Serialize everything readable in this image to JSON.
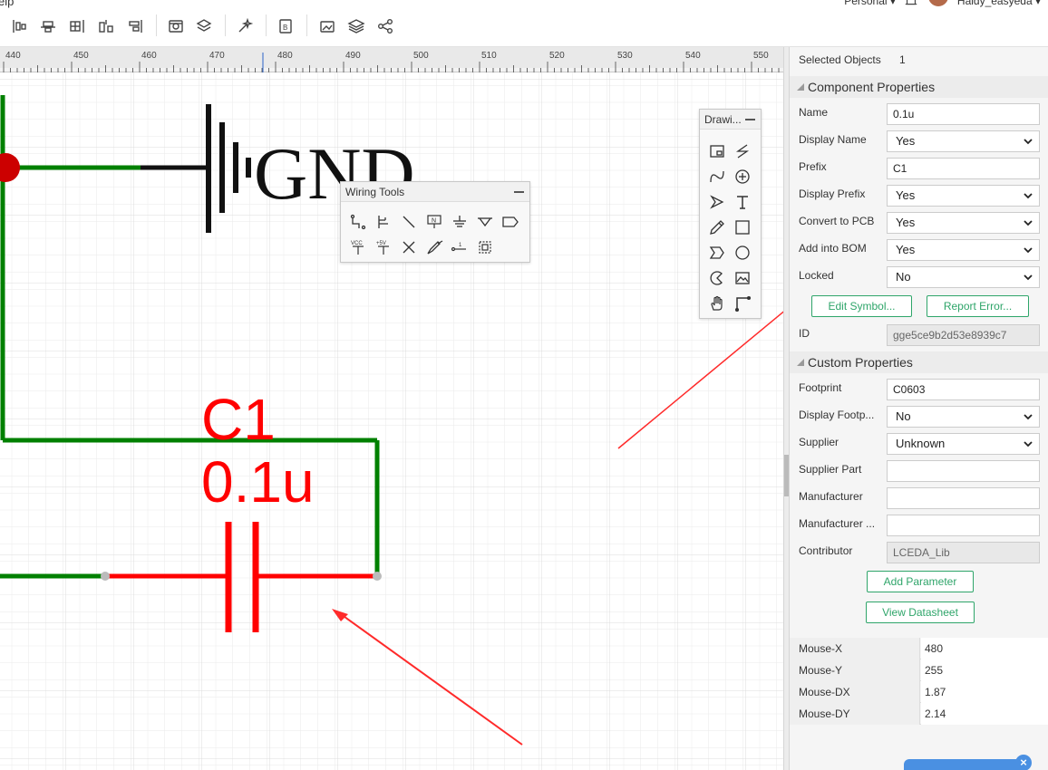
{
  "menu": {
    "help": "elp"
  },
  "user": {
    "workspace": "Personal ▾",
    "username": "Haidy_easyeda ▾"
  },
  "toolbar": {
    "icons": [
      "align-left-icon",
      "align-center-icon",
      "distribute-icon",
      "align-bottom-icon",
      "align-right-icon",
      "image-icon",
      "layers-up-icon",
      "magic-wand-icon",
      "bom-icon",
      "image-export-icon",
      "layers-icon",
      "share-icon"
    ]
  },
  "ruler": {
    "labels": [
      "440",
      "450",
      "460",
      "470",
      "480",
      "490",
      "500",
      "510",
      "520",
      "530",
      "540",
      "550"
    ]
  },
  "schematic": {
    "gnd_label": "GND",
    "ref": "C1",
    "value": "0.1u",
    "wire_color": "#008000",
    "part_color": "#ff0000",
    "junction_color": "#cc0000"
  },
  "wiring_tools": {
    "title": "Wiring Tools",
    "tools": [
      "wire-icon",
      "bus-icon",
      "bus-entry-icon",
      "net-label-icon",
      "ground-icon",
      "net-port-icon",
      "net-flag-icon",
      "vcc-icon",
      "plus5v-icon",
      "no-connect-icon",
      "voltage-probe-icon",
      "pin-icon",
      "group-icon"
    ]
  },
  "drawing_tools": {
    "title": "Drawi...",
    "tools": [
      "rect-image-icon",
      "line-icon",
      "curve-icon",
      "add-circle-icon",
      "arrow-icon",
      "text-icon",
      "pencil-icon",
      "square-icon",
      "chevron-icon",
      "circle-icon",
      "pie-icon",
      "image-icon",
      "hand-icon",
      "corner-icon"
    ]
  },
  "panel": {
    "selected_objects_label": "Selected Objects",
    "selected_objects_value": "1",
    "component_header": "Component Properties",
    "name_label": "Name",
    "name_value": "0.1u",
    "display_name_label": "Display Name",
    "display_name_value": "Yes",
    "prefix_label": "Prefix",
    "prefix_value": "C1",
    "display_prefix_label": "Display Prefix",
    "display_prefix_value": "Yes",
    "convert_pcb_label": "Convert to PCB",
    "convert_pcb_value": "Yes",
    "add_bom_label": "Add into BOM",
    "add_bom_value": "Yes",
    "locked_label": "Locked",
    "locked_value": "No",
    "edit_symbol": "Edit Symbol...",
    "report_error": "Report Error...",
    "id_label": "ID",
    "id_value": "gge5ce9b2d53e8939c7",
    "custom_header": "Custom Properties",
    "footprint_label": "Footprint",
    "footprint_value": "C0603",
    "display_footprint_label": "Display Footp...",
    "display_footprint_value": "No",
    "supplier_label": "Supplier",
    "supplier_value": "Unknown",
    "supplier_part_label": "Supplier Part",
    "supplier_part_value": "",
    "manufacturer_label": "Manufacturer",
    "manufacturer_value": "",
    "manufacturer_part_label": "Manufacturer ...",
    "manufacturer_part_value": "",
    "contributor_label": "Contributor",
    "contributor_value": "LCEDA_Lib",
    "add_parameter": "Add Parameter",
    "view_datasheet": "View Datasheet"
  },
  "mouse": {
    "rows": [
      {
        "key": "Mouse-X",
        "value": "480"
      },
      {
        "key": "Mouse-Y",
        "value": "255"
      },
      {
        "key": "Mouse-DX",
        "value": "1.87"
      },
      {
        "key": "Mouse-DY",
        "value": "2.14"
      }
    ]
  },
  "colors": {
    "accent": "#2fa56a",
    "annotation_arrow": "#ff2a2a"
  }
}
